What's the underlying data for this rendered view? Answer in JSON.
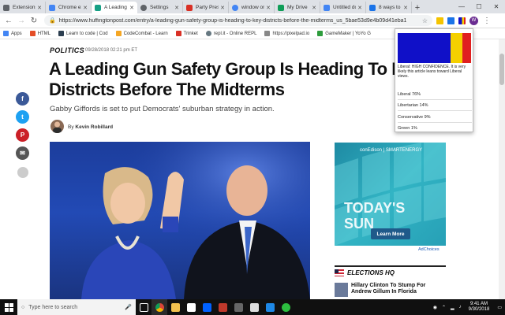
{
  "browser": {
    "tabs": [
      {
        "label": "Extensions",
        "color": "#5f6368"
      },
      {
        "label": "Chrome ext",
        "color": "#4285f4"
      },
      {
        "label": "A Leading",
        "color": "#16a085",
        "active": true
      },
      {
        "label": "Settings",
        "color": "#5f6368"
      },
      {
        "label": "Party Pres",
        "color": "#d93025"
      },
      {
        "label": "window on",
        "color": "#4285f4"
      },
      {
        "label": "My Drive",
        "color": "#0f9d58"
      },
      {
        "label": "Untitled do",
        "color": "#4285f4"
      },
      {
        "label": "8 ways to",
        "color": "#1a73e8"
      }
    ],
    "url": "https://www.huffingtonpost.com/entry/a-leading-gun-safety-group-is-heading-to-key-districts-before-the-midterms_us_5bae53d9e4b09d41eba12b29",
    "bookmarks": [
      {
        "label": "Apps",
        "color": "#4285f4"
      },
      {
        "label": "HTML",
        "color": "#e44d26"
      },
      {
        "label": "Learn to code | Cod",
        "color": "#2c3e50"
      },
      {
        "label": "CodeCombat - Learn",
        "color": "#f5a623"
      },
      {
        "label": "Trinket",
        "color": "#d93025"
      },
      {
        "label": "repl.it - Online REPL",
        "color": "#667881"
      },
      {
        "label": "https://pixelpad.io",
        "color": "#888888"
      },
      {
        "label": "GameMaker | YoYo G",
        "color": "#2d9c3c"
      }
    ],
    "avatar_letter": "W"
  },
  "article": {
    "section": "POLITICS",
    "date": "09/28/2018 02:21 pm ET",
    "headline_line1": "A Leading Gun Safety Group Is Heading To K",
    "headline_line2": "Districts Before The Midterms",
    "subhead": "Gabby Giffords is set to put Democrats' suburban strategy in action.",
    "author_prefix": "By",
    "author": "Kevin Robillard"
  },
  "share": [
    {
      "name": "facebook",
      "glyph": "f",
      "color": "#3b5998"
    },
    {
      "name": "twitter",
      "glyph": "t",
      "color": "#1da1f2"
    },
    {
      "name": "pinterest",
      "glyph": "P",
      "color": "#cb2027"
    },
    {
      "name": "email",
      "glyph": "✉",
      "color": "#555555"
    },
    {
      "name": "comment",
      "glyph": "",
      "color": "#cccccc"
    }
  ],
  "ad": {
    "brand": "conEdison | SMARTENERGY",
    "line1": "TODAY'S",
    "line2": "SUN",
    "button": "Learn More",
    "choices": "AdChoices"
  },
  "sidebar": {
    "elections_title": "ELECTIONS HQ",
    "story_line1": "Hillary Clinton To Stump For",
    "story_line2": "Andrew Gillum In Florida"
  },
  "popup": {
    "flag_colors": [
      "#1010c8",
      "#f5d000",
      "#e02020"
    ],
    "summary": "Liberal: HIGH CONFIDENCE. It is very likely this article leans toward Liberal views.",
    "scores": [
      {
        "label": "Liberal 76%"
      },
      {
        "label": "Libertarian 14%"
      },
      {
        "label": "Conservative 9%"
      },
      {
        "label": "Green 1%"
      }
    ]
  },
  "taskbar": {
    "search_placeholder": "Type here to search",
    "time": "9:41 AM",
    "date": "9/30/2018"
  }
}
